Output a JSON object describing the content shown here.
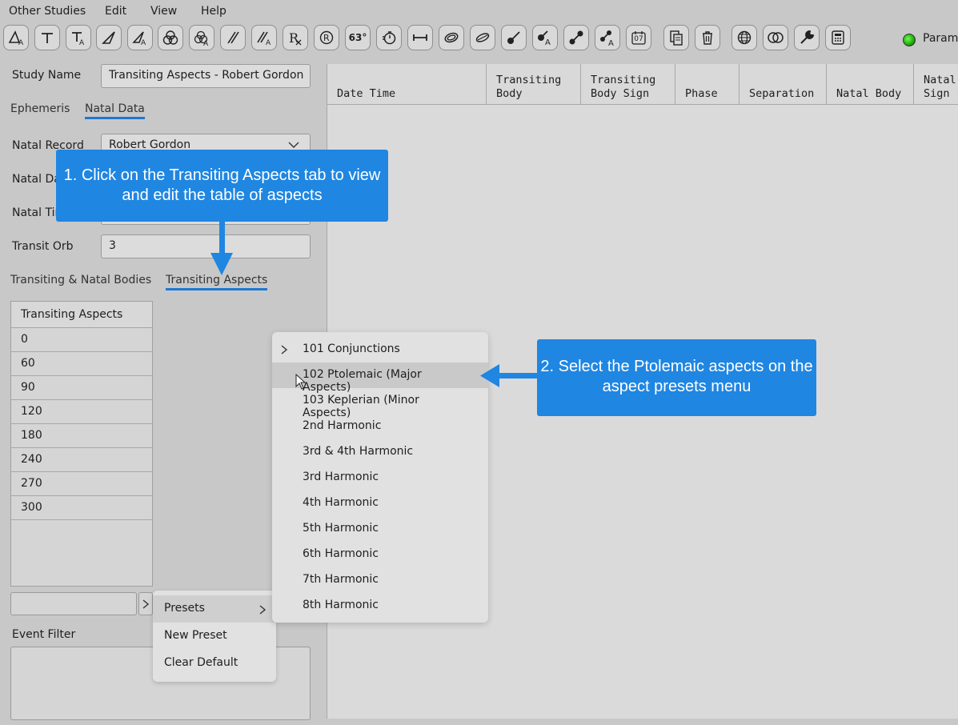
{
  "menu": {
    "other_studies": "Other Studies",
    "edit": "Edit",
    "view": "View",
    "help": "Help"
  },
  "toolbar": {
    "degree_label": "63°",
    "date_label": "07",
    "params_label": "Parame",
    "status_color": "#2ecc18"
  },
  "study": {
    "name_label": "Study Name",
    "name_value": "Transiting Aspects - Robert Gordon"
  },
  "tabs_top": {
    "ephemeris": "Ephemeris",
    "natal_data": "Natal Data"
  },
  "natal": {
    "record_label": "Natal Record",
    "record_value": "Robert Gordon",
    "date_label": "Natal Da",
    "time_label": "Natal Tin",
    "orb_label": "Transit Orb",
    "orb_value": "3"
  },
  "tabs_bottom": {
    "bodies": "Transiting & Natal Bodies",
    "aspects": "Transiting Aspects"
  },
  "aspects": {
    "header": "Transiting Aspects",
    "rows": [
      "0",
      "60",
      "90",
      "120",
      "180",
      "240",
      "270",
      "300"
    ]
  },
  "event_filter_label": "Event Filter",
  "results_columns": [
    "Date Time",
    "Transiting\nBody",
    "Transiting\nBody Sign",
    "Phase",
    "Separation",
    "Natal Body",
    "Natal\nSign"
  ],
  "presets_menu": [
    "Presets",
    "New Preset",
    "Clear Default"
  ],
  "aspect_presets": [
    "101 Conjunctions",
    "102 Ptolemaic (Major Aspects)",
    "103 Keplerian (Minor Aspects)",
    "2nd Harmonic",
    "3rd & 4th Harmonic",
    "3rd Harmonic",
    "4th Harmonic",
    "5th Harmonic",
    "6th Harmonic",
    "7th Harmonic",
    "8th Harmonic"
  ],
  "callouts": {
    "step1": "1. Click on the Transiting Aspects tab to view and edit the table of aspects",
    "step2": "2. Select the Ptolemaic aspects on the aspect presets menu",
    "color": "#1f86e2"
  }
}
